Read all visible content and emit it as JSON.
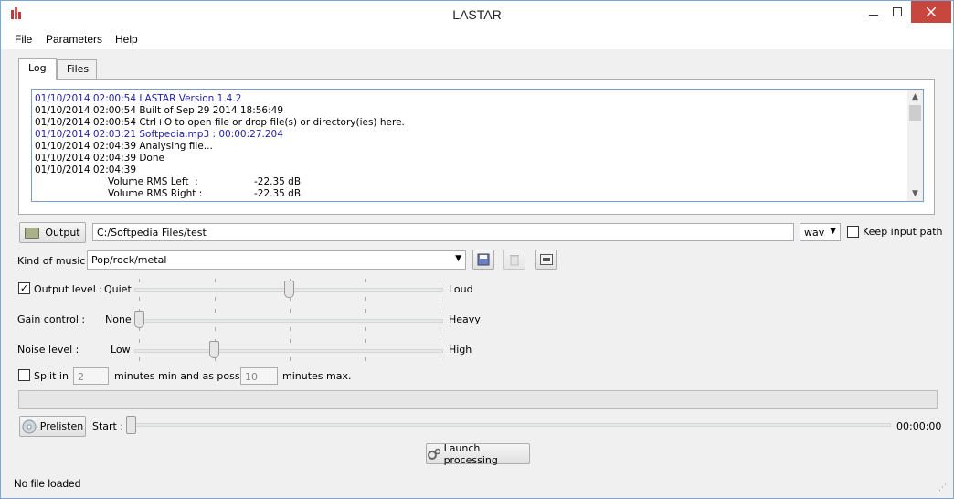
{
  "window": {
    "title": "LASTAR"
  },
  "menu": {
    "file": "File",
    "parameters": "Parameters",
    "help": "Help"
  },
  "tabs": [
    {
      "label": "Log"
    },
    {
      "label": "Files"
    }
  ],
  "log": {
    "lines": [
      {
        "text": "01/10/2014 02:00:54 LASTAR Version 1.4.2",
        "color": "#1f1fa8"
      },
      {
        "text": "01/10/2014 02:00:54 Built of Sep 29 2014 18:56:49",
        "color": "#000000"
      },
      {
        "text": "01/10/2014 02:00:54 Ctrl+O to open file or drop file(s) or directory(ies) here.",
        "color": "#000000"
      },
      {
        "text": "01/10/2014 02:03:21 Softpedia.mp3 : 00:00:27.204",
        "color": "#1f1fa8"
      },
      {
        "text": "01/10/2014 02:04:39 Analysing file...",
        "color": "#000000"
      },
      {
        "text": "01/10/2014 02:04:39 Done",
        "color": "#000000"
      },
      {
        "text": "01/10/2014 02:04:39",
        "color": "#000000"
      }
    ],
    "detail_rows": [
      {
        "key": "Volume RMS Left  :",
        "value": "-22.35 dB"
      },
      {
        "key": "Volume RMS Right :",
        "value": "-22.35 dB"
      }
    ]
  },
  "output": {
    "button_label": "Output",
    "path": "C:/Softpedia Files/test",
    "format": "wav",
    "keep_input_path_label": "Keep input path",
    "keep_input_path_checked": false
  },
  "music": {
    "label": "Kind of music :",
    "selected": "Pop/rock/metal"
  },
  "output_level": {
    "label": "Output level :",
    "enabled": true,
    "min_label": "Quiet",
    "max_label": "Loud",
    "value": 0.5
  },
  "gain_control": {
    "label": "Gain control :",
    "min_label": "None",
    "max_label": "Heavy",
    "value": 0.0
  },
  "noise_level": {
    "label": "Noise level :",
    "min_label": "Low",
    "max_label": "High",
    "value": 0.25
  },
  "split": {
    "label": "Split in",
    "enabled": false,
    "min_value": "2",
    "mid_text": "minutes min and as possible",
    "max_value": "10",
    "end_text": "minutes max."
  },
  "prelisten": {
    "button_label": "Prelisten",
    "start_label": "Start :",
    "time": "00:00:00"
  },
  "launch": {
    "button_label": "Launch processing"
  },
  "status": {
    "text": "No file loaded"
  },
  "colors": {
    "accent": "#7aa7d6",
    "close": "#c7463d",
    "log_blue": "#1f1fa8"
  }
}
